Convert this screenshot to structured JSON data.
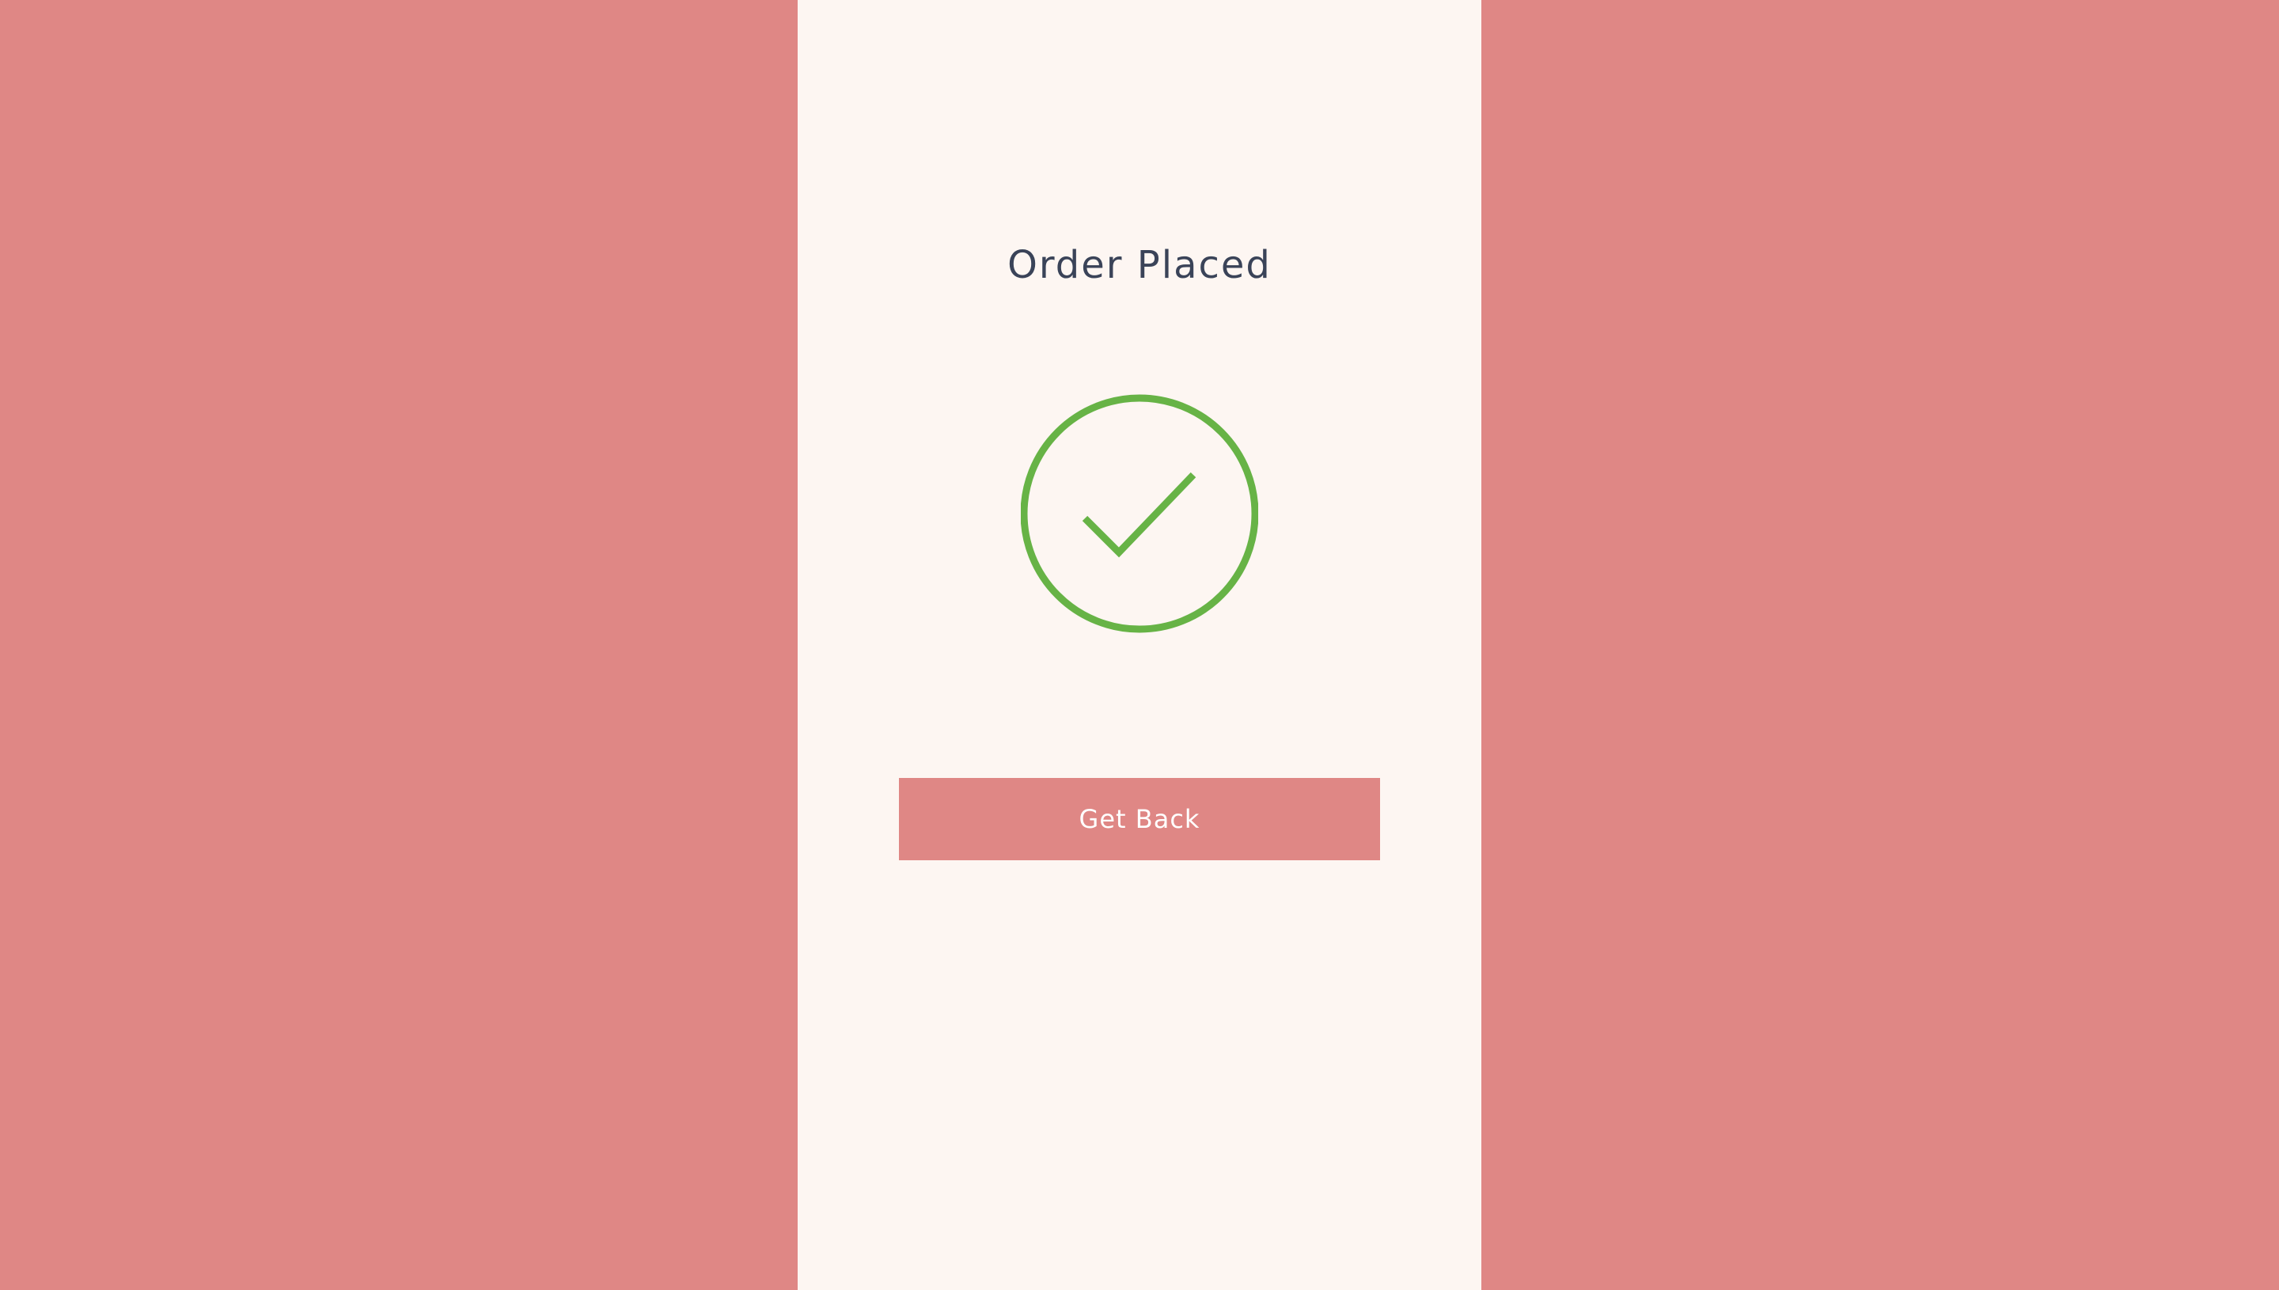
{
  "page": {
    "title": "Order Placed"
  },
  "status": {
    "icon": "check-circle-icon",
    "color": "#67b346"
  },
  "actions": {
    "get_back_label": "Get Back"
  },
  "colors": {
    "background": "#df8785",
    "panel": "#fdf6f2",
    "title_text": "#3a4358",
    "button": "#df8785",
    "button_text": "#ffffff"
  }
}
